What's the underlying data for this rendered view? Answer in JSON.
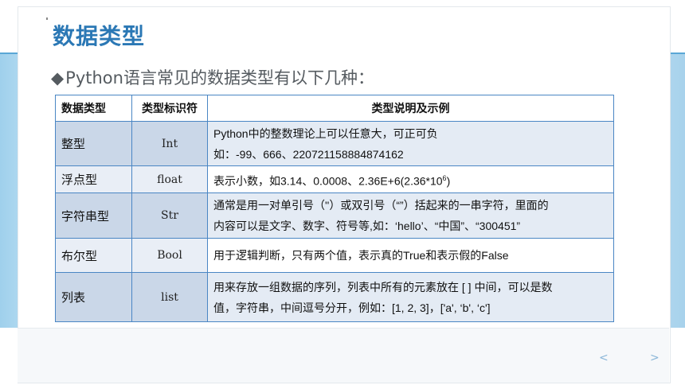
{
  "slide": {
    "title": "数据类型",
    "subtitle": "Python语言常见的数据类型有以下几种：",
    "subtitle_bullet": "◆"
  },
  "table": {
    "headers": [
      "数据类型",
      "类型标识符",
      "类型说明及示例"
    ],
    "rows": [
      {
        "type": "整型",
        "identifier": "Int",
        "desc_line1": "Python中的整数理论上可以任意大，可正可负",
        "desc_line2": "如：-99、666、220721158884874162"
      },
      {
        "type": "浮点型",
        "identifier": "float",
        "desc_main": "表示小数，如3.14、0.0008、2.36E+6(2.36*10",
        "desc_sup": "6",
        "desc_tail": ")"
      },
      {
        "type": "字符串型",
        "identifier": "Str",
        "desc_line1": "通常是用一对单引号（''）或双引号（“”）括起来的一串字符，里面的",
        "desc_line2": "内容可以是文字、数字、符号等,如：‘hello’、“中国”、“300451”"
      },
      {
        "type": "布尔型",
        "identifier": "Bool",
        "desc_line1": "用于逻辑判断，只有两个值，表示真的True和表示假的False"
      },
      {
        "type": "列表",
        "identifier": "list",
        "desc_line1": "用来存放一组数据的序列，列表中所有的元素放在 [ ] 中间，可以是数",
        "desc_line2": "值，字符串，中间逗号分开，例如：[1, 2, 3]，['a', ‘b', ‘c']"
      }
    ]
  },
  "nav": {
    "prev": "<",
    "next": ">"
  }
}
